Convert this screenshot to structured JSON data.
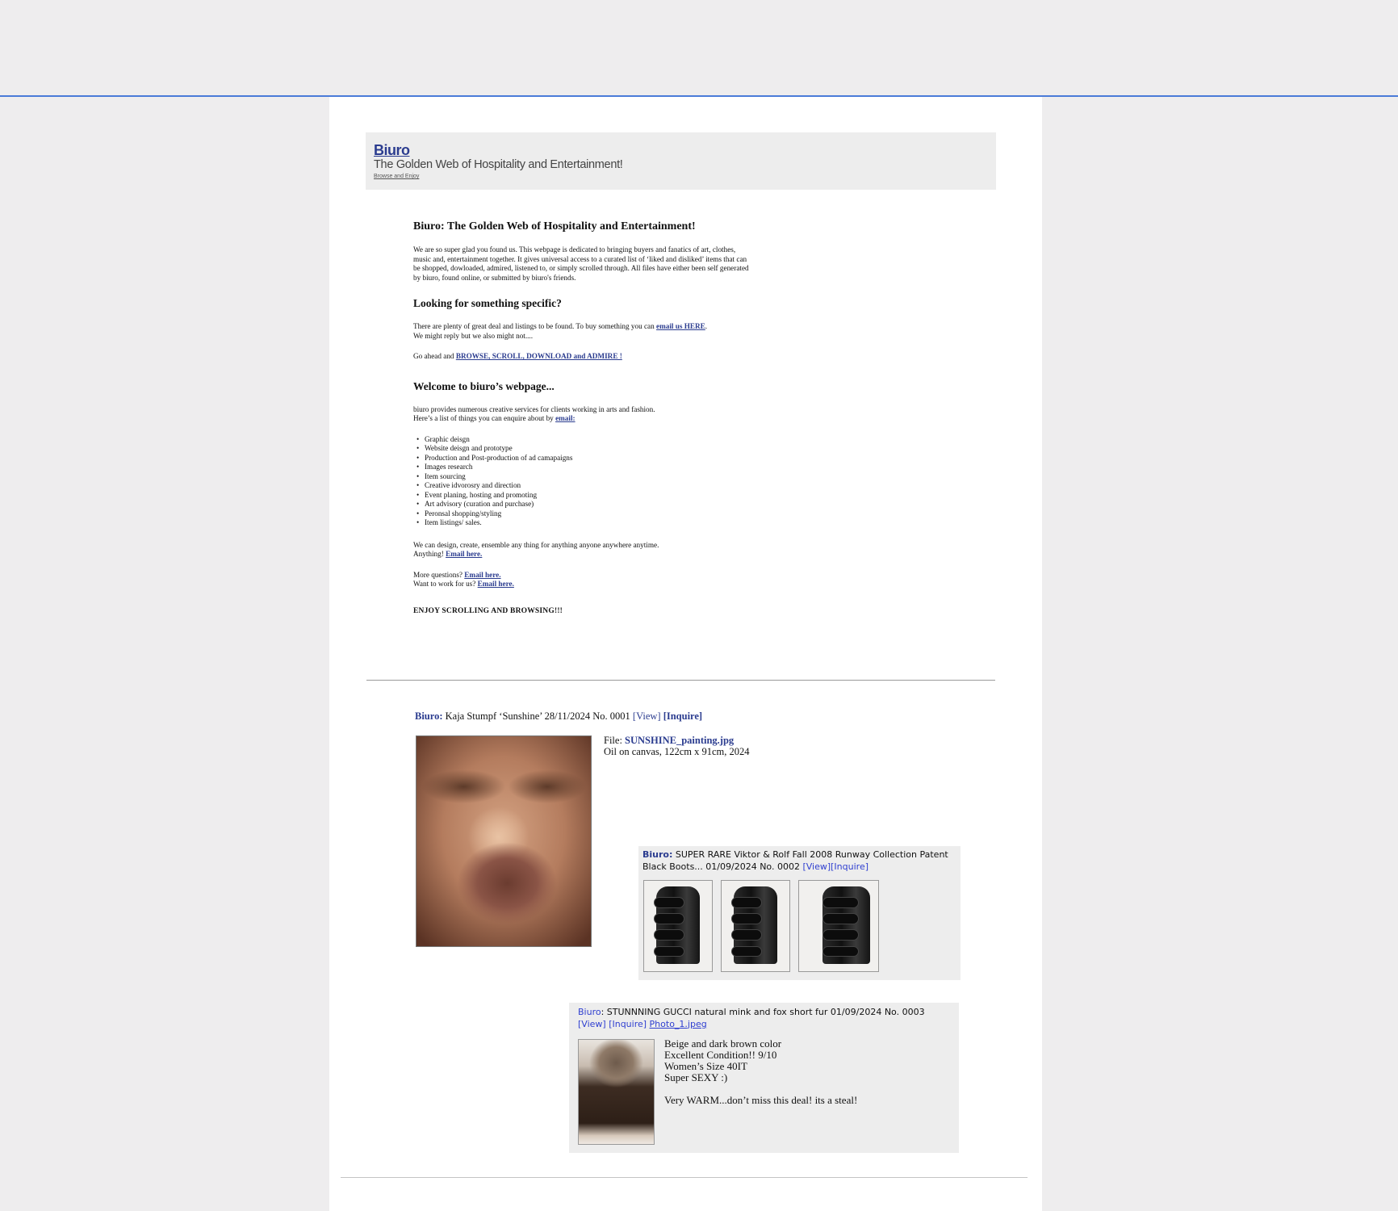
{
  "site": {
    "logo": "Biuro",
    "tagline": "The Golden Web of Hospitality and Entertainment!",
    "sub": "Browse and Enjoy"
  },
  "intro": {
    "title": "Biuro: The Golden Web of Hospitality and Entertainment!",
    "paragraph": "We are so super glad you found us. This webpage is dedicated to bringing buyers and fanatics of art, clothes, music and, entertainment together. It gives universal access to a curated list of ‘liked and disliked’  items that can be shopped, dowloaded, admired, listened to, or simply scrolled through. All files have either been self generated by biuro, found online, or submitted by biuro's friends.",
    "looking_heading": "Looking for something specific?",
    "looking_text": "There are plenty of great deal and listings to be found. To buy something you can ",
    "looking_link": "email us HERE",
    "looking_end": ".",
    "reply_text": "We might reply but we also might not....",
    "browse_prefix": "Go ahead and ",
    "browse_link": "BROWSE, SCROLL, DOWNLOAD and ADMIRE !",
    "welcome_heading": "Welcome to biuro’s webpage...",
    "services_line1": "biuro provides numerous creative services for clients working in arts and fashion.",
    "services_line2": "Here’s a list of things you can enquire about by ",
    "services_link": "email:",
    "services": [
      "Graphic deisgn",
      "Website deisgn and prototype",
      "Production and Post-production of ad camapaigns",
      "Images research",
      "Item sourcing",
      "Creative idvorosry and direction",
      "Event planing, hosting and promoting",
      "Art advisory (curation and purchase)",
      "Peronsal shopping/styling",
      "Item listings/ sales."
    ],
    "design_line": "We can design, create, ensemble any thing for anything anyone anywhere anytime.",
    "anything_prefix": "Anything! ",
    "anything_link": "Email here.",
    "questions_prefix": "More questions? ",
    "questions_link": "Email here.",
    "work_prefix": "Want to work for us? ",
    "work_link": "Email here.",
    "enjoy": "ENJOY SCROLLING AND BROWSING!!!"
  },
  "post1": {
    "who": "Biuro:",
    "text": " Kaja Stumpf ‘Sunshine’ 28/11/2024 No. 0001 ",
    "view": "[View]",
    "inquire": "[Inquire]",
    "file_label": "File: ",
    "file_name": "SUNSHINE_painting.jpg",
    "medium": "Oil on canvas, 122cm x 91cm, 2024"
  },
  "post2": {
    "who": "Biuro:",
    "text": " SUPER RARE Viktor & Rolf Fall 2008 Runway Collection Patent Black Boots... 01/09/2024 No. 0002 ",
    "view": "[View]",
    "inquire": "[Inquire]"
  },
  "post3": {
    "who": "Biuro",
    "text": ": STUNNNING GUCCI natural mink and fox short fur 01/09/2024 No. 0003",
    "view": "[View]",
    "inquire": "[Inquire]",
    "photo": "Photo_1.jpeg",
    "desc": [
      "Beige and dark brown color",
      "Excellent Condition!! 9/10",
      "Women’s Size 40IT",
      "Super SEXY :)"
    ],
    "pitch": "Very WARM...don’t miss this deal! its a steal!"
  },
  "colors": {
    "link": "#2b3c8f",
    "accent_line": "#4a7bd8",
    "panel": "#ededed"
  }
}
